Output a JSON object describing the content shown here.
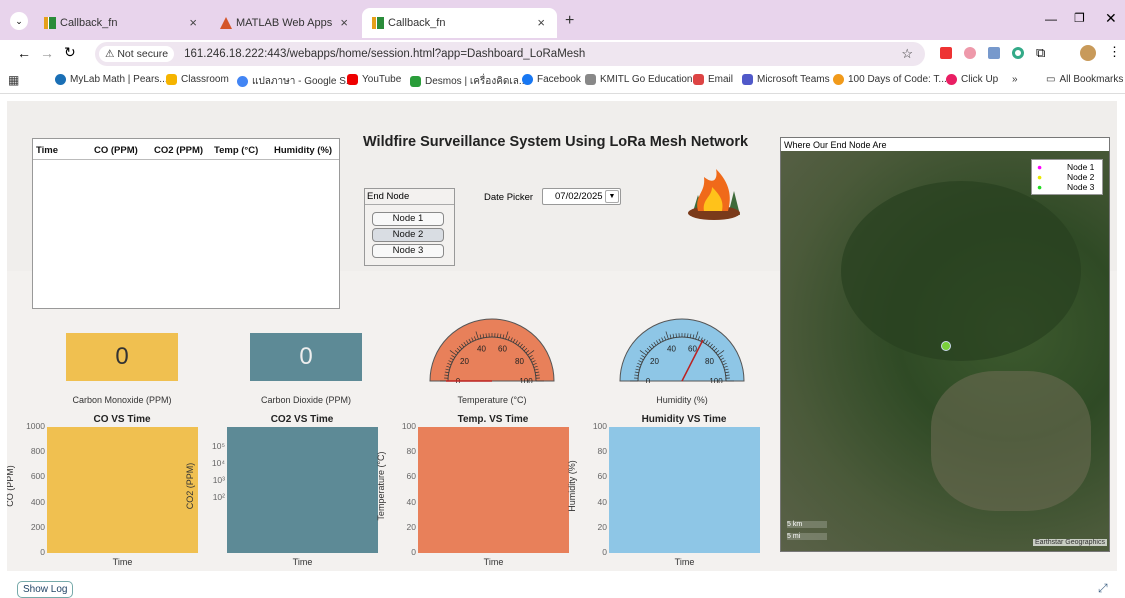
{
  "browser": {
    "tabs": [
      {
        "label": "Callback_fn"
      },
      {
        "label": "MATLAB Web Apps"
      },
      {
        "label": "Callback_fn"
      }
    ],
    "new_tab": "+",
    "security": "Not secure",
    "url": "161.246.18.222:443/webapps/home/session.html?app=Dashboard_LoRaMesh",
    "bookmarks": [
      "MyLab Math | Pears...",
      "Classroom",
      "แปลภาษา - Google S...",
      "YouTube",
      "Desmos | เครื่องคิดเล...",
      "Facebook",
      "KMITL Go Education",
      "Email",
      "Microsoft Teams",
      "100 Days of Code: T...",
      "Click Up",
      "»",
      "All Bookmarks"
    ]
  },
  "table": {
    "headers": [
      "Time",
      "CO (PPM)",
      "CO2 (PPM)",
      "Temp (°C)",
      "Humidity (%)"
    ],
    "rows": []
  },
  "title": "Wildfire Surveillance System Using LoRa Mesh Network",
  "end_node": {
    "label": "End Node",
    "options": [
      "Node 1",
      "Node 2",
      "Node 3"
    ],
    "selected": "Node 2"
  },
  "date_picker": {
    "label": "Date Picker",
    "value": "07/02/2025"
  },
  "map": {
    "title": "Where Our End Node Are",
    "legend": [
      "Node 1",
      "Node 2",
      "Node 3"
    ],
    "legend_colors": [
      "#ff00ff",
      "#ffff00",
      "#22dd22"
    ],
    "scale_km": "5 km",
    "scale_mi": "5 mi",
    "attribution": "Earthstar Geographics"
  },
  "readouts": {
    "co": {
      "value": "0",
      "caption": "Carbon Monoxide (PPM)",
      "color": "#f0c050"
    },
    "co2": {
      "value": "0",
      "caption": "Carbon Dioxide (PPM)",
      "color": "#5d8a96"
    }
  },
  "gauges": {
    "temperature": {
      "caption": "Temperature (°C)",
      "ticks": [
        "0",
        "20",
        "40",
        "60",
        "80",
        "100"
      ],
      "value": 0,
      "color": "#e8805a"
    },
    "humidity": {
      "caption": "Humidity (%)",
      "ticks": [
        "0",
        "20",
        "40",
        "60",
        "80",
        "100"
      ],
      "value": 65,
      "color": "#8ec6e6"
    }
  },
  "charts": [
    {
      "title": "CO VS Time",
      "xlabel": "Time",
      "ylabel": "CO (PPM)",
      "ticks": [
        "1000",
        "800",
        "600",
        "400",
        "200",
        "0"
      ],
      "color": "#f0c050"
    },
    {
      "title": "CO2 VS Time",
      "xlabel": "Time",
      "ylabel": "CO2 (PPM)",
      "ticks": [
        "10⁵",
        "10⁴",
        "10³",
        "10²"
      ],
      "color": "#5d8a96"
    },
    {
      "title": "Temp. VS Time",
      "xlabel": "Time",
      "ylabel": "Temperature (°C)",
      "ticks": [
        "100",
        "80",
        "60",
        "40",
        "20",
        "0"
      ],
      "color": "#e8805a"
    },
    {
      "title": "Humidity VS Time",
      "xlabel": "Time",
      "ylabel": "Humidity (%)",
      "ticks": [
        "100",
        "80",
        "60",
        "40",
        "20",
        "0"
      ],
      "color": "#8ec6e6"
    }
  ],
  "footer": {
    "show_log": "Show Log"
  }
}
